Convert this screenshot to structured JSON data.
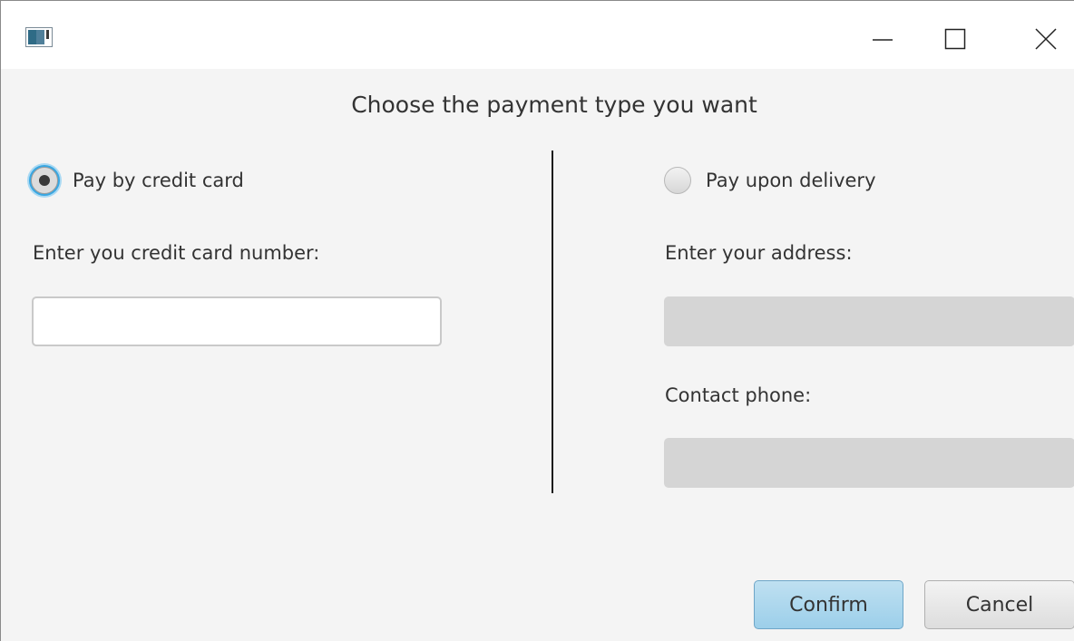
{
  "window": {
    "title": "",
    "controls": {
      "minimize_icon": "minimize-icon",
      "maximize_icon": "maximize-icon",
      "close_icon": "close-icon"
    }
  },
  "dialog": {
    "heading": "Choose the payment type you want",
    "credit_card": {
      "radio_label": "Pay by credit card",
      "selected": true,
      "number_label": "Enter you credit card number:",
      "number_value": ""
    },
    "delivery": {
      "radio_label": "Pay upon delivery",
      "selected": false,
      "address_label": "Enter your address:",
      "address_value": "",
      "phone_label": "Contact phone:",
      "phone_value": ""
    },
    "buttons": {
      "confirm": "Confirm",
      "cancel": "Cancel"
    }
  },
  "colors": {
    "accent_focus": "#39a7e2",
    "confirm_button": "#9ccfea",
    "disabled_field": "#d5d5d5"
  }
}
